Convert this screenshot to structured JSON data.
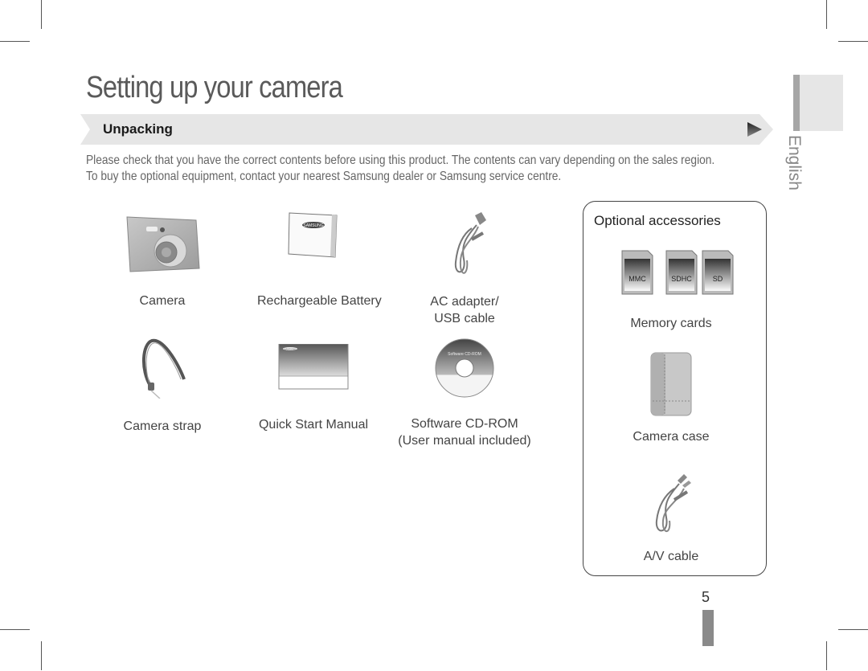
{
  "page": {
    "title": "Setting up your camera",
    "section": {
      "label": "Unpacking",
      "arrow_icon": "right-triangle-icon"
    },
    "intro_lines": [
      "Please check that you have the correct contents before using this product. The contents can vary depending on the sales region.",
      "To buy the optional equipment, contact your nearest Samsung dealer or Samsung service centre."
    ],
    "language_tab": "English",
    "page_number": "5"
  },
  "included_items": [
    {
      "name": "camera",
      "lines": [
        "Camera"
      ]
    },
    {
      "name": "battery",
      "lines": [
        "Rechargeable Battery"
      ],
      "logo": "SAMSUNG"
    },
    {
      "name": "ac-adapter-usb-cable",
      "lines": [
        "AC adapter/",
        "USB cable"
      ]
    },
    {
      "name": "camera-strap",
      "lines": [
        "Camera strap"
      ]
    },
    {
      "name": "quick-start-manual",
      "lines": [
        "Quick Start Manual"
      ],
      "logo": "SAMSUNG"
    },
    {
      "name": "software-cd-rom",
      "lines": [
        "Software CD-ROM",
        "(User manual included)"
      ],
      "disc_label": "Software CD-ROM"
    }
  ],
  "optional": {
    "title": "Optional accessories",
    "memory_cards": {
      "labels": [
        "MMC",
        "SDHC",
        "SD"
      ],
      "caption": "Memory cards"
    },
    "camera_case": {
      "caption": "Camera case"
    },
    "av_cable": {
      "caption": "A/V cable"
    }
  }
}
